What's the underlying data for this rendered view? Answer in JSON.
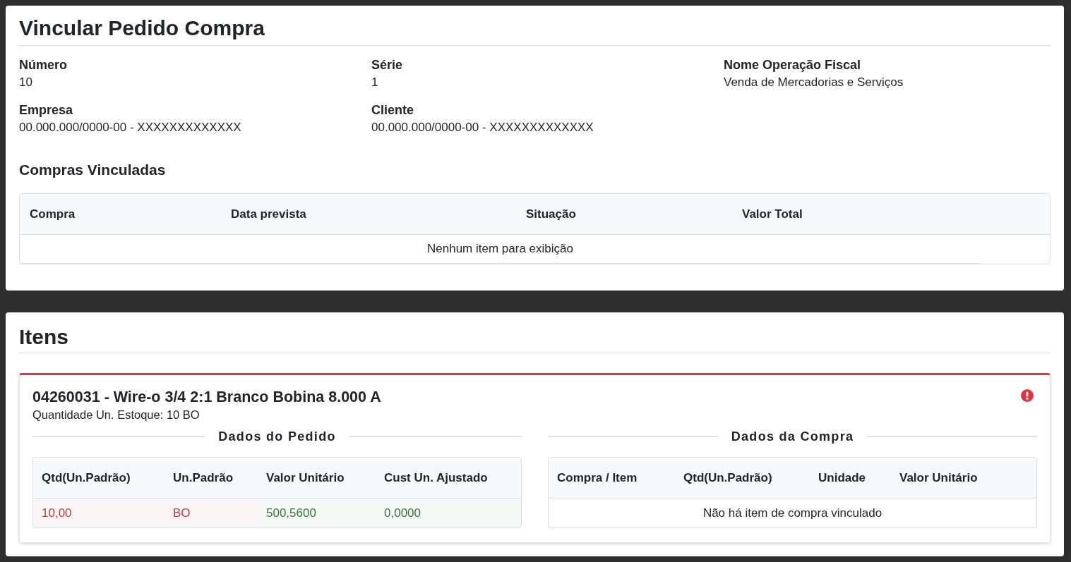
{
  "header": {
    "title": "Vincular Pedido Compra"
  },
  "fields": [
    {
      "label": "Número",
      "value": "10"
    },
    {
      "label": "Série",
      "value": "1"
    },
    {
      "label": "Nome Operação Fiscal",
      "value": "Venda de Mercadorias e Serviços"
    },
    {
      "label": "Empresa",
      "value": "00.000.000/0000-00 - XXXXXXXXXXXXX"
    },
    {
      "label": "Cliente",
      "value": "00.000.000/0000-00 - XXXXXXXXXXXXX"
    }
  ],
  "linked_purchases": {
    "title": "Compras Vinculadas",
    "columns": [
      "Compra",
      "Data prevista",
      "Situação",
      "Valor Total"
    ],
    "empty_message": "Nenhum item para exibição"
  },
  "items_section": {
    "title": "Itens",
    "items": [
      {
        "title": "04260031 - Wire-o 3/4 2:1 Branco Bobina 8.000 A",
        "stock_quantity": "Quantidade Un. Estoque: 10 BO",
        "has_error": true,
        "order_data": {
          "title": "Dados do Pedido",
          "columns": [
            "Qtd(Un.Padrão)",
            "Un.Padrão",
            "Valor Unitário",
            "Cust Un. Ajustado"
          ],
          "rows": [
            [
              {
                "text": "10,00",
                "color": "#a94442"
              },
              {
                "text": "BO",
                "color": "#a94442"
              },
              {
                "text": "500,5600",
                "color": "#3c763d"
              },
              {
                "text": "0,0000",
                "color": "#3c763d"
              }
            ]
          ]
        },
        "purchase_data": {
          "title": "Dados da Compra",
          "columns": [
            "Compra / Item",
            "Qtd(Un.Padrão)",
            "Unidade",
            "Valor Unitário"
          ],
          "empty_message": "Não há item de compra vinculado"
        }
      }
    ]
  }
}
